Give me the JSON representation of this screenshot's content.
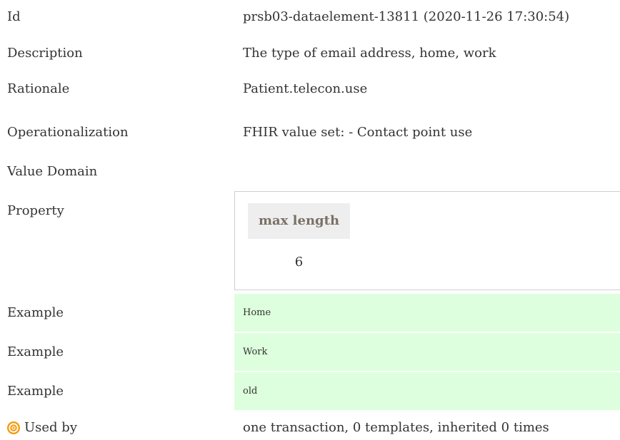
{
  "rows": {
    "id": {
      "label": "Id",
      "value": "prsb03-dataelement-13811 (2020-11-26 17:30:54)"
    },
    "description": {
      "label": "Description",
      "value": "The type of email address, home, work"
    },
    "rationale": {
      "label": "Rationale",
      "value": "Patient.telecon.use"
    },
    "operationalization": {
      "label": "Operationalization",
      "value": "FHIR value set: - Contact point use"
    },
    "value_domain": {
      "label": "Value Domain"
    }
  },
  "property": {
    "label": "Property",
    "header": "max length",
    "value": "6"
  },
  "examples": [
    {
      "label": "Example",
      "value": "Home"
    },
    {
      "label": "Example",
      "value": "Work"
    },
    {
      "label": "Example",
      "value": "old"
    }
  ],
  "used_by": {
    "icon": "target-icon",
    "label": "Used by",
    "value": "one transaction, 0 templates, inherited 0 times",
    "icon_color": "#f39c12"
  },
  "colors": {
    "example_background": "#ddffdd",
    "property_header_background": "#eeeeee",
    "property_header_text": "#7a7066",
    "text": "#333333"
  }
}
